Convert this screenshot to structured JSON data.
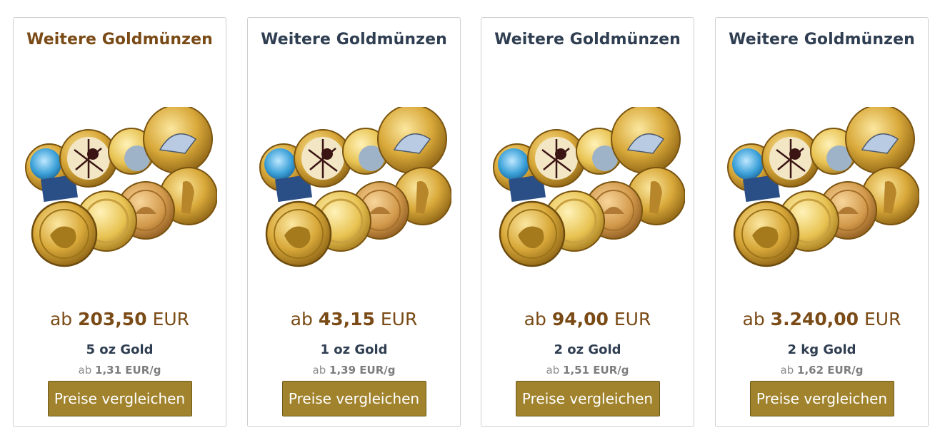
{
  "cards": [
    {
      "title": "Weitere Goldmünzen",
      "price_prefix": "ab",
      "price_value": "203,50",
      "currency": "EUR",
      "weight": "5 oz Gold",
      "per_gram_prefix": "ab",
      "per_gram_value": "1,31 EUR/g",
      "button": "Preise vergleichen"
    },
    {
      "title": "Weitere Goldmünzen",
      "price_prefix": "ab",
      "price_value": "43,15",
      "currency": "EUR",
      "weight": "1 oz Gold",
      "per_gram_prefix": "ab",
      "per_gram_value": "1,39 EUR/g",
      "button": "Preise vergleichen"
    },
    {
      "title": "Weitere Goldmünzen",
      "price_prefix": "ab",
      "price_value": "94,00",
      "currency": "EUR",
      "weight": "2 oz Gold",
      "per_gram_prefix": "ab",
      "per_gram_value": "1,51 EUR/g",
      "button": "Preise vergleichen"
    },
    {
      "title": "Weitere Goldmünzen",
      "price_prefix": "ab",
      "price_value": "3.240,00",
      "currency": "EUR",
      "weight": "2 kg Gold",
      "per_gram_prefix": "ab",
      "per_gram_value": "1,62 EUR/g",
      "button": "Preise vergleichen"
    }
  ],
  "colors": {
    "title_active": "#7a4b16",
    "title_default": "#2f3e51",
    "price": "#7a4b16",
    "button_bg": "#a1832d"
  }
}
